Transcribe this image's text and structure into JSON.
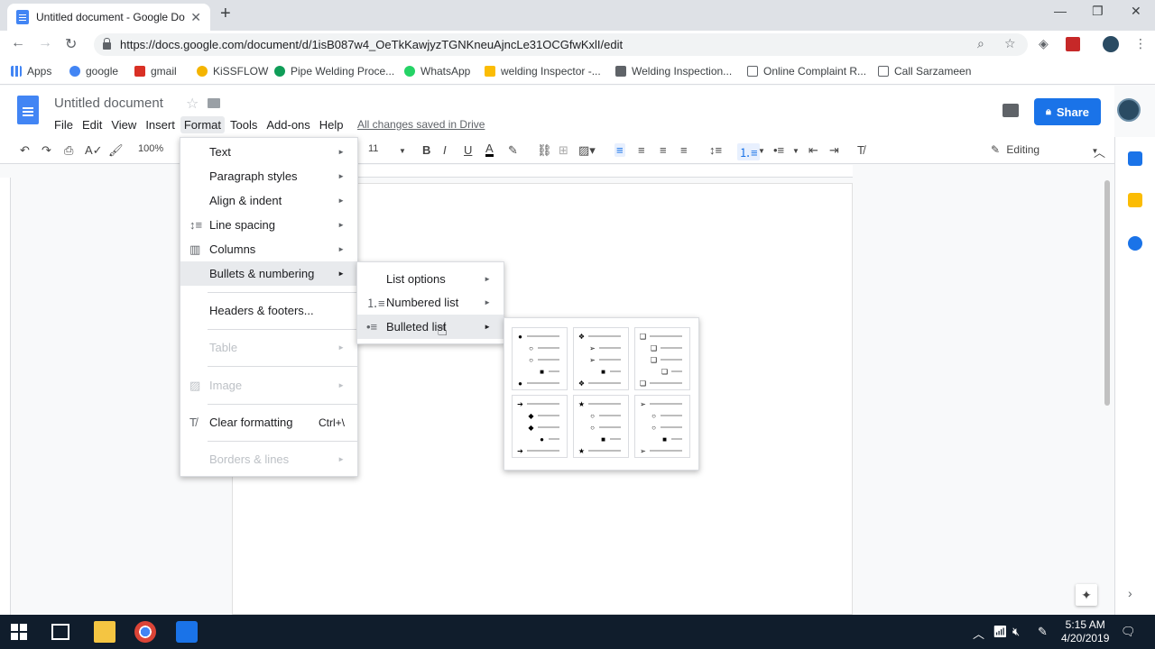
{
  "browser": {
    "tab_title": "Untitled document - Google Doc",
    "url": "https://docs.google.com/document/d/1isB087w4_OeTkKawjyzTGNKneuAjncLe31OCGfwKxlI/edit",
    "bookmarks": [
      "Apps",
      "google",
      "gmail",
      "KiSSFLOW",
      "Pipe Welding Proce...",
      "WhatsApp",
      "welding Inspector -...",
      "Welding Inspection...",
      "Online Complaint R...",
      "Call Sarzameen"
    ]
  },
  "docs": {
    "title": "Untitled document",
    "menus": [
      "File",
      "Edit",
      "View",
      "Insert",
      "Format",
      "Tools",
      "Add-ons",
      "Help"
    ],
    "saved_status": "All changes saved in Drive",
    "share_label": "Share",
    "zoom": "100%",
    "font_size": "11",
    "mode": "Editing"
  },
  "format_menu": {
    "items": [
      {
        "label": "Text",
        "arrow": true
      },
      {
        "label": "Paragraph styles",
        "arrow": true
      },
      {
        "label": "Align & indent",
        "arrow": true
      },
      {
        "label": "Line spacing",
        "arrow": true
      },
      {
        "label": "Columns",
        "arrow": true
      },
      {
        "label": "Bullets & numbering",
        "arrow": true
      },
      {
        "label": "Headers & footers...",
        "arrow": false
      },
      {
        "label": "Table",
        "arrow": true
      },
      {
        "label": "Image",
        "arrow": true
      },
      {
        "label": "Clear formatting",
        "shortcut": "Ctrl+\\"
      },
      {
        "label": "Borders & lines",
        "arrow": true
      }
    ]
  },
  "bullets_submenu": {
    "items": [
      "List options",
      "Numbered list",
      "Bulleted list"
    ]
  },
  "taskbar": {
    "time": "5:15 AM",
    "date": "4/20/2019"
  }
}
